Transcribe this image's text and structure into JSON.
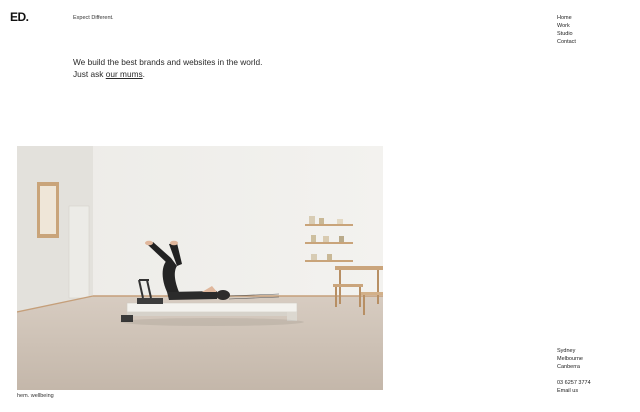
{
  "brand": {
    "logo": "ED.",
    "tagline": "Expect Different."
  },
  "nav": {
    "items": [
      "Home",
      "Work",
      "Studio",
      "Contact"
    ]
  },
  "hero": {
    "line1": "We build the best brands and websites in the world.",
    "line2_prefix": "Just ask ",
    "line2_link": "our mums",
    "line2_suffix": "."
  },
  "project": {
    "caption": "hem. wellbeing"
  },
  "footer": {
    "cities": [
      "Sydney",
      "Melbourne",
      "Canberra"
    ],
    "phone": "03 6257 3774",
    "email_label": "Email us"
  }
}
